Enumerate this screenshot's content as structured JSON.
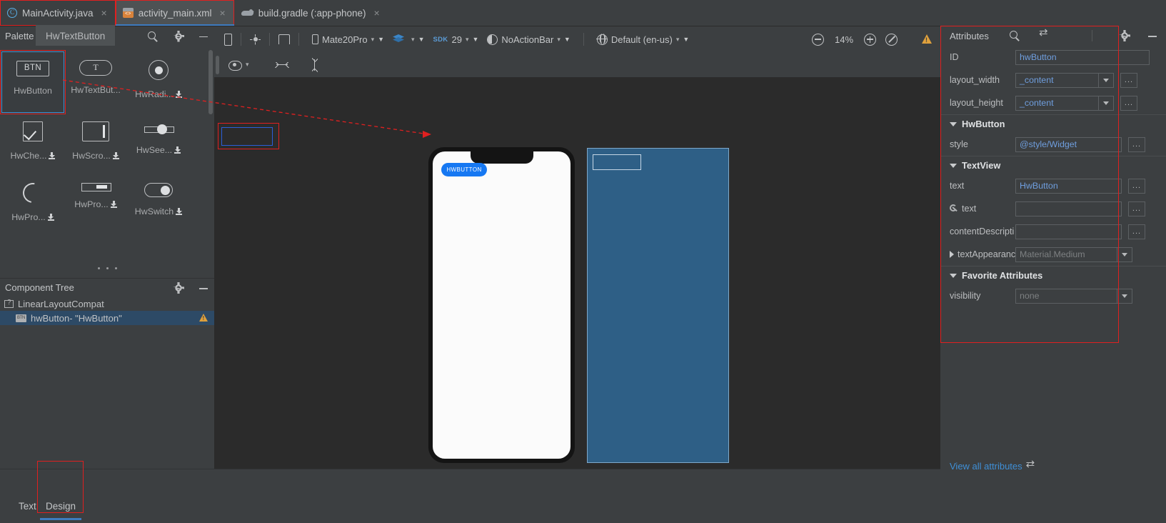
{
  "editor_tabs": [
    {
      "label": "MainActivity.java",
      "icon": "java-class-icon",
      "active": false,
      "boxed": false,
      "close": "×"
    },
    {
      "label": "activity_main.xml",
      "icon": "xml-layout-icon",
      "active": true,
      "boxed": true,
      "close": "×"
    },
    {
      "label": "build.gradle (:app-phone)",
      "icon": "gradle-icon",
      "active": false,
      "boxed": false,
      "close": "×"
    }
  ],
  "palette": {
    "title": "Palette",
    "tooltip": "HwTextButton",
    "actions": [
      {
        "name": "search-icon"
      },
      {
        "name": "gear-icon"
      },
      {
        "name": "minimize-icon"
      }
    ],
    "items": [
      {
        "label": "HwButton",
        "glyph": "BTN",
        "icon": "button-icon",
        "selected": true,
        "download": false
      },
      {
        "label": "HwTextBut...",
        "glyph": "T",
        "icon": "text-button-icon",
        "selected": false,
        "download": false
      },
      {
        "label": "HwRadi...",
        "glyph": "",
        "icon": "radio-button-icon",
        "selected": false,
        "download": true
      },
      {
        "label": "HwChe...",
        "glyph": "",
        "icon": "checkbox-icon",
        "selected": false,
        "download": true
      },
      {
        "label": "HwScro...",
        "glyph": "",
        "icon": "scrollview-icon",
        "selected": false,
        "download": true
      },
      {
        "label": "HwSee...",
        "glyph": "",
        "icon": "seekbar-icon",
        "selected": false,
        "download": true
      },
      {
        "label": "HwPro...",
        "glyph": "",
        "icon": "progressbar-circle-icon",
        "selected": false,
        "download": true
      },
      {
        "label": "HwPro...",
        "glyph": "",
        "icon": "progressbar-bar-icon",
        "selected": false,
        "download": true
      },
      {
        "label": "HwSwitch",
        "glyph": "",
        "icon": "switch-icon",
        "selected": false,
        "download": true
      }
    ]
  },
  "component_tree": {
    "title": "Component Tree",
    "actions": [
      {
        "name": "gear-icon"
      },
      {
        "name": "minimize-icon"
      }
    ],
    "rows": [
      {
        "label": "LinearLayoutCompat",
        "icon": "layout-icon",
        "indent": false,
        "selected": false,
        "warning": false
      },
      {
        "label": "hwButton- \"HwButton\"",
        "icon": "widget-button-icon",
        "indent": true,
        "selected": true,
        "warning": true
      }
    ]
  },
  "design_toolbar": {
    "device_mode_icon": "phone-device-icon",
    "theme_brightness_icon": "brightness-icon",
    "orientation_icon": "orientation-icon",
    "device": "Mate20Pro",
    "layers_label": "",
    "sdk_prefix": "SDK",
    "sdk": "29",
    "theme": "NoActionBar",
    "locale": "Default (en-us)",
    "zoom_out_icon": "zoom-out-icon",
    "zoom_value": "14%",
    "zoom_in_icon": "zoom-in-icon",
    "zoom_fit_icon": "zoom-fit-icon",
    "warning_icon": "warning-icon"
  },
  "design_subtoolbar": {
    "eye_icon": "visibility-eye-icon",
    "hstretch_icon": "horizontal-resize-icon",
    "vstretch_icon": "vertical-resize-icon"
  },
  "preview": {
    "button_text": "HWBUTTON",
    "button_color": "#1678f2",
    "selection_color": "#2b5fd9",
    "blueprint_fill": "#2e5f86",
    "blueprint_stroke": "#7fa8c9",
    "annotation_color": "#e02020"
  },
  "bottom_tabs": [
    {
      "label": "Text",
      "active": false,
      "boxed": false
    },
    {
      "label": "Design",
      "active": true,
      "boxed": true
    }
  ],
  "attributes": {
    "title": "Attributes",
    "actions": [
      {
        "name": "search-icon"
      },
      {
        "name": "swap-icon"
      },
      {
        "name": "gear-icon"
      },
      {
        "name": "minimize-icon"
      }
    ],
    "rows": [
      {
        "kind": "field",
        "label": "ID",
        "value": "hwButton",
        "dots": false
      },
      {
        "kind": "combo",
        "label": "layout_width",
        "value": "_content",
        "dots": true
      },
      {
        "kind": "combo",
        "label": "layout_height",
        "value": "_content",
        "dots": true
      },
      {
        "kind": "section",
        "label": "HwButton",
        "expanded": true
      },
      {
        "kind": "field",
        "label": "style",
        "value": "@style/Widget",
        "dots": true
      },
      {
        "kind": "section",
        "label": "TextView",
        "expanded": true
      },
      {
        "kind": "field",
        "label": "text",
        "value": "HwButton",
        "dots": true
      },
      {
        "kind": "field",
        "label": "text",
        "value": "",
        "dots": true,
        "wrench": true
      },
      {
        "kind": "field",
        "label": "contentDescripti",
        "value": "",
        "dots": true
      },
      {
        "kind": "combo",
        "label": "textAppearanc",
        "value": "Material.Medium",
        "dots": false,
        "collapsed": true,
        "grey": true
      },
      {
        "kind": "section",
        "label": "Favorite Attributes",
        "expanded": true
      },
      {
        "kind": "combo",
        "label": "visibility",
        "value": "none",
        "dots": false,
        "grey": true
      }
    ],
    "view_all_label": "View all attributes",
    "view_all_icon": "swap-icon"
  }
}
